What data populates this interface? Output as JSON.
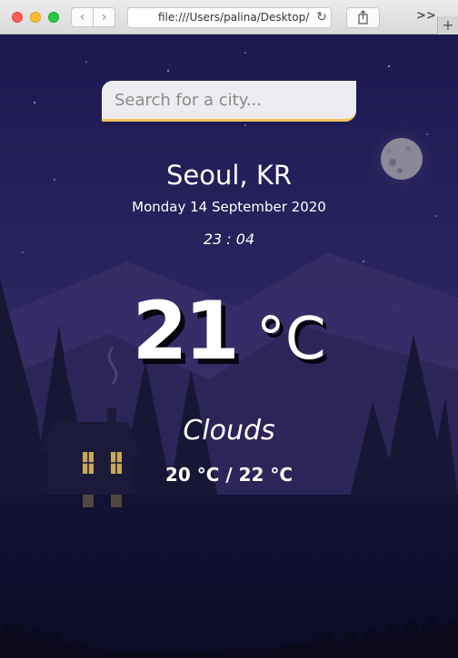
{
  "browser": {
    "url": "file:///Users/palina/Desktop/",
    "back_icon": "chevron-left-icon",
    "forward_icon": "chevron-right-icon",
    "reload_icon": "reload-icon",
    "share_icon": "share-icon",
    "more_label": ">>",
    "new_tab_label": "+"
  },
  "search": {
    "placeholder": "Search for a city..."
  },
  "location": {
    "city": "Seoul, KR",
    "date": "Monday 14 September 2020",
    "time": "23 : 04"
  },
  "current": {
    "temp": "21",
    "unit": "°C",
    "condition": "Clouds",
    "hi_low": "20 °C / 22 °C"
  },
  "colors": {
    "sky_top": "#1e1a55",
    "sky_bottom": "#2b2458",
    "accent": "#f0c35a",
    "moon": "#8e8a9a"
  }
}
